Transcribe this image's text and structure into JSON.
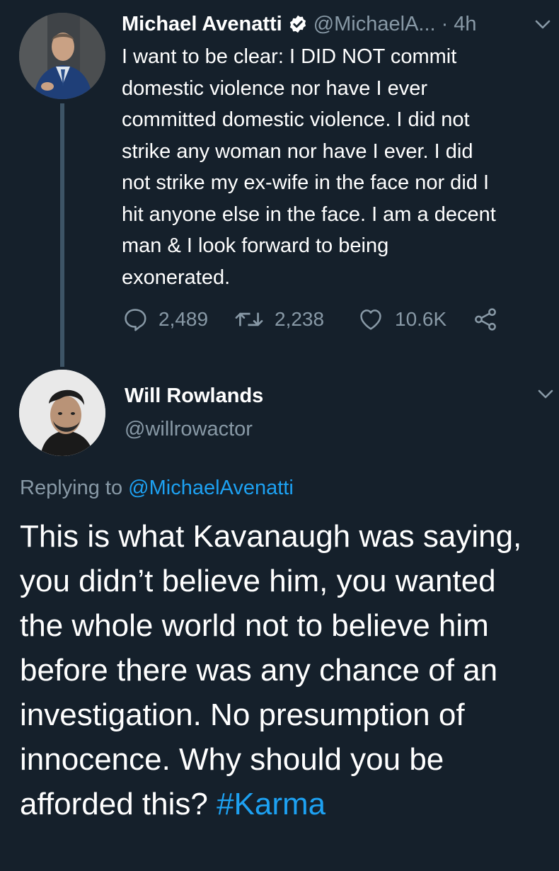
{
  "tweet1": {
    "author_name": "Michael Avenatti",
    "verified": true,
    "handle": "@MichaelA...",
    "time": "· 4h",
    "text": "I want to be clear: I DID NOT commit\ndomestic violence nor have I ever\ncommitted domestic violence. I did not\nstrike any woman nor have I ever. I did\nnot strike my ex-wife in the face nor did I\nhit anyone else in the face. I am a decent\nman & I look forward to being\nexonerated.",
    "replies": "2,489",
    "retweets": "2,238",
    "likes": "10.6K",
    "icons": {
      "reply": "reply-icon",
      "retweet": "retweet-icon",
      "like": "heart-icon",
      "share": "share-icon",
      "menu": "chevron-down-icon",
      "badge": "verified-badge-icon"
    }
  },
  "tweet2": {
    "author_name": "Will Rowlands",
    "handle": "@willrowactor",
    "replying_prefix": "Replying to ",
    "replying_to": "@MichaelAvenatti",
    "text": "This is what Kavanaugh was saying, you didn’t believe him, you wanted the whole world not to believe him before there was any chance of an investigation. No presumption of innocence. Why should you be afforded this? ",
    "hashtag": "#Karma"
  },
  "colors": {
    "background": "#15202b",
    "secondary_text": "#8899a6",
    "accent": "#1da1f2",
    "thread_line": "#3d5466"
  }
}
